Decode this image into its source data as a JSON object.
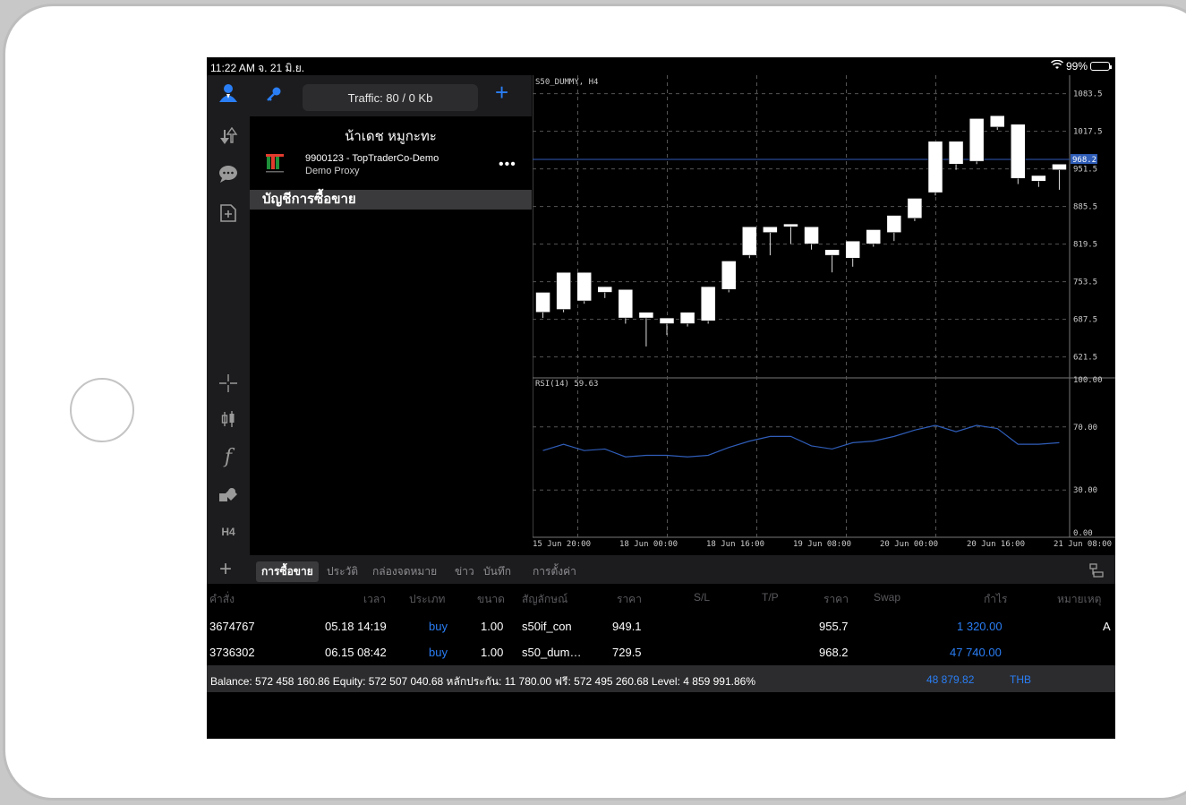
{
  "status": {
    "time": "11:22 AM  จ. 21 มิ.ย.",
    "battery": "99%"
  },
  "left_toolbar": {
    "tf_label": "H4"
  },
  "account_panel": {
    "traffic": "Traffic: 80 / 0 Kb",
    "name": "น้าเดช หมูกะทะ",
    "account_line": "9900123 - TopTraderCo-Demo",
    "server": "Demo Proxy",
    "more": "•••",
    "section": "บัญชีการซื้อขาย"
  },
  "chart": {
    "symbol_label": "S50_DUMMY, H4",
    "current_price": "968.2",
    "price_ticks": [
      "1083.5",
      "1017.5",
      "951.5",
      "885.5",
      "819.5",
      "753.5",
      "687.5",
      "621.5"
    ],
    "rsi_label": "RSI(14) 59.63",
    "rsi_ticks": [
      "100.00",
      "70.00",
      "30.00",
      "0.00"
    ],
    "time_labels": [
      "15 Jun 20:00",
      "18 Jun 00:00",
      "18 Jun 16:00",
      "19 Jun 08:00",
      "20 Jun 00:00",
      "20 Jun 16:00",
      "21 Jun 08:00"
    ],
    "colors": {
      "bull": "#ffffff",
      "bear": "#ffffff",
      "rsi": "#2f5db8",
      "grid": "#555555",
      "price_line": "#2f5db8"
    }
  },
  "chart_data": {
    "type": "candlestick",
    "price_ylim": [
      588,
      1116
    ],
    "ohlc": [
      [
        700,
        735,
        690,
        735
      ],
      [
        705,
        770,
        700,
        770
      ],
      [
        720,
        770,
        715,
        770
      ],
      [
        745,
        735,
        725,
        745
      ],
      [
        740,
        690,
        680,
        740
      ],
      [
        690,
        700,
        640,
        680
      ],
      [
        680,
        690,
        660,
        690
      ],
      [
        680,
        700,
        675,
        690
      ],
      [
        685,
        745,
        680,
        745
      ],
      [
        740,
        790,
        735,
        790
      ],
      [
        800,
        850,
        795,
        850
      ],
      [
        840,
        850,
        800,
        850
      ],
      [
        850,
        855,
        820,
        820
      ],
      [
        820,
        850,
        810,
        820
      ],
      [
        810,
        800,
        770,
        800
      ],
      [
        795,
        825,
        780,
        825
      ],
      [
        820,
        845,
        815,
        825
      ],
      [
        840,
        870,
        825,
        870
      ],
      [
        865,
        900,
        860,
        900
      ],
      [
        910,
        1000,
        905,
        1000
      ],
      [
        960,
        1000,
        950,
        1000
      ],
      [
        965,
        1040,
        960,
        1040
      ],
      [
        1025,
        1045,
        1020,
        1045
      ],
      [
        1030,
        935,
        925,
        940
      ],
      [
        930,
        940,
        920,
        940
      ],
      [
        950,
        960,
        915,
        950
      ]
    ],
    "rsi_ylim": [
      0,
      100
    ],
    "rsi_values": [
      55,
      59,
      55,
      56,
      51,
      52,
      52,
      51,
      52,
      57,
      61,
      64,
      64,
      58,
      56,
      60,
      61,
      64,
      68,
      71,
      67,
      71,
      69,
      59,
      59,
      60
    ]
  },
  "tabs": [
    "การซื้อขาย",
    "ประวัติ",
    "กล่องจดหมาย",
    "ข่าว",
    "บันทึก",
    "การตั้งค่า"
  ],
  "table": {
    "headers": [
      "คำสั่ง",
      "เวลา",
      "ประเภท",
      "ขนาด",
      "สัญลักษณ์",
      "ราคา",
      "S/L",
      "T/P",
      "ราคา",
      "Swap",
      "กำไร",
      "หมายเหตุ"
    ],
    "rows": [
      {
        "ticket": "3674767",
        "time": "05.18 14:19",
        "type": "buy",
        "size": "1.00",
        "symbol": "s50if_con",
        "price": "949.1",
        "sl": "",
        "tp": "",
        "cur": "955.7",
        "swap": "",
        "profit": "1 320.00",
        "note": "A"
      },
      {
        "ticket": "3736302",
        "time": "06.15 08:42",
        "type": "buy",
        "size": "1.00",
        "symbol": "s50_dum…",
        "price": "729.5",
        "sl": "",
        "tp": "",
        "cur": "968.2",
        "swap": "",
        "profit": "47 740.00",
        "note": ""
      }
    ]
  },
  "summary": {
    "text": "Balance: 572 458 160.86 Equity: 572 507 040.68 หลักประกัน: 11 780.00 ฟรี: 572 495 260.68 Level: 4 859 991.86%",
    "total": "48 879.82",
    "currency": "THB"
  }
}
